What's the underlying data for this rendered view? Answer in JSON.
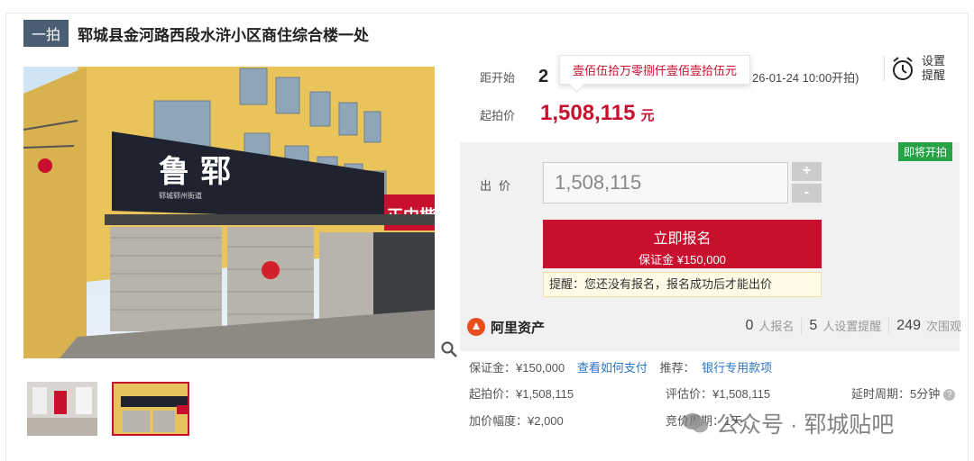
{
  "header": {
    "tag": "一拍",
    "title": "郓城县金河路西段水浒小区商住综合楼一处"
  },
  "countdown": {
    "label": "距开始",
    "value": "2",
    "start_time": "26-01-24 10:00开拍)",
    "tooltip": "壹佰伍拾万零捌仟壹佰壹拾伍元"
  },
  "remind": {
    "line1": "设置",
    "line2": "提醒",
    "icon": "alarm-clock-icon"
  },
  "start_price": {
    "label": "起拍价",
    "value": "1,508,115",
    "unit": "元"
  },
  "status_badge": "即将开拍",
  "bid": {
    "label": "出价",
    "value": "1,508,115",
    "plus": "+",
    "minus": "-"
  },
  "apply": {
    "label": "立即报名",
    "deposit": "保证金 ¥150,000"
  },
  "hint": "提醒：您还没有报名，报名成功后才能出价",
  "ali": {
    "brand": "阿里资产",
    "stats": [
      {
        "num": "0",
        "label": "人报名"
      },
      {
        "num": "5",
        "label": "人设置提醒"
      },
      {
        "num": "249",
        "label": "次围观"
      }
    ]
  },
  "details": {
    "deposit": "保证金：¥150,000",
    "pay_link": "查看如何支付",
    "recommend_label": "推荐：",
    "recommend_link": "银行专用款项",
    "start_price": "起拍价：¥1,508,115",
    "eval_price": "评估价：¥1,508,115",
    "delay": "延时周期：5分钟",
    "increment": "加价幅度：¥2,000",
    "cycle": "竞价周期：1天"
  },
  "sign": {
    "main": "鲁 郓",
    "sub": "郓城郓州街道",
    "right": "正中楷"
  },
  "watermark": "公众号 · 郓城贴吧",
  "colors": {
    "accent": "#c8102e",
    "badge": "#27a246",
    "tag": "#4a5d72",
    "link": "#2d73c4"
  }
}
